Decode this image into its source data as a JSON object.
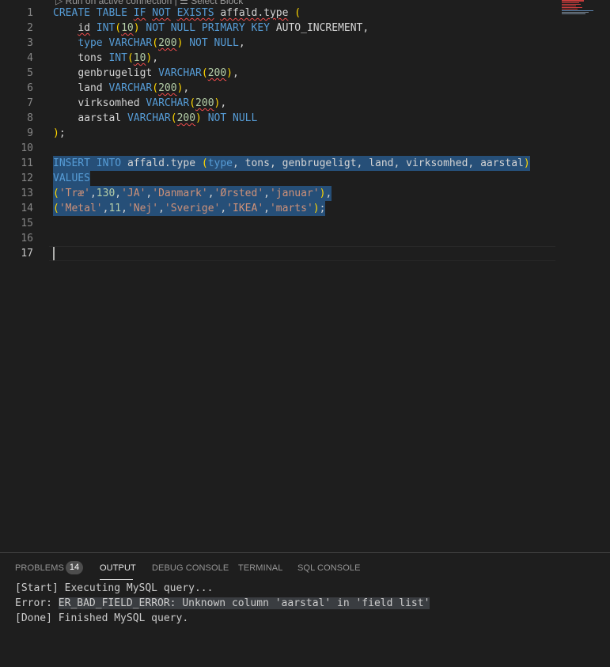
{
  "editor": {
    "codelens": "▷ Run on active connection | ☰ Select Block",
    "active_line": 17,
    "lines": [
      {
        "n": "1"
      },
      {
        "n": "2"
      },
      {
        "n": "3"
      },
      {
        "n": "4"
      },
      {
        "n": "5"
      },
      {
        "n": "6"
      },
      {
        "n": "7"
      },
      {
        "n": "8"
      },
      {
        "n": "9"
      },
      {
        "n": "10"
      },
      {
        "n": "11"
      },
      {
        "n": "12"
      },
      {
        "n": "13"
      },
      {
        "n": "14"
      },
      {
        "n": "15"
      },
      {
        "n": "16"
      },
      {
        "n": "17"
      }
    ],
    "code": {
      "l1": {
        "t1": "CREATE",
        "t2": "TABLE",
        "t3": "IF",
        "t4": "NOT",
        "t5": "EXISTS",
        "t6": "affald.type",
        "t7": "("
      },
      "l2": {
        "t1": "id",
        "t2": "INT",
        "t3": "(",
        "t4": "10",
        "t5": ")",
        "t6": "NOT",
        "t7": "NULL",
        "t8": "PRIMARY",
        "t9": "KEY",
        "t10": "AUTO_INCREMENT,"
      },
      "l3": {
        "t1": "type",
        "t2": "VARCHAR",
        "t3": "(",
        "t4": "200",
        "t5": ")",
        "t6": "NOT",
        "t7": "NULL",
        "t8": ","
      },
      "l4": {
        "t1": "tons",
        "t2": "INT",
        "t3": "(",
        "t4": "10",
        "t5": ")",
        "t6": ","
      },
      "l5": {
        "t1": "genbrugeligt",
        "t2": "VARCHAR",
        "t3": "(",
        "t4": "200",
        "t5": ")",
        "t6": ","
      },
      "l6": {
        "t1": "land",
        "t2": "VARCHAR",
        "t3": "(",
        "t4": "200",
        "t5": ")",
        "t6": ","
      },
      "l7": {
        "t1": "virksomhed",
        "t2": "VARCHAR",
        "t3": "(",
        "t4": "200",
        "t5": ")",
        "t6": ","
      },
      "l8": {
        "t1": "aarstal",
        "t2": "VARCHAR",
        "t3": "(",
        "t4": "200",
        "t5": ")",
        "t6": "NOT",
        "t7": "NULL"
      },
      "l9": {
        "t1": ")",
        "t2": ";"
      },
      "l11": {
        "t1": "INSERT",
        "t2": "INTO",
        "t3": "affald.type",
        "t4": "(",
        "t5": "type",
        "t6": ", tons, genbrugeligt, land, virksomhed, aarstal",
        "t7": ")"
      },
      "l12": {
        "t1": "VALUES"
      },
      "l13": {
        "t1": "(",
        "t2": "'Træ'",
        "t3": ",",
        "t4": "130",
        "t5": ",",
        "t6": "'JA'",
        "t7": ",",
        "t8": "'Danmark'",
        "t9": ",",
        "t10": "'Ørsted'",
        "t11": ",",
        "t12": "'januar'",
        "t13": ")",
        "t14": ","
      },
      "l14": {
        "t1": "(",
        "t2": "'Metal'",
        "t3": ",",
        "t4": "11",
        "t5": ",",
        "t6": "'Nej'",
        "t7": ",",
        "t8": "'Sverige'",
        "t9": ",",
        "t10": "'IKEA'",
        "t11": ",",
        "t12": "'marts'",
        "t13": ")",
        "t14": ";"
      }
    }
  },
  "panel": {
    "tabs": {
      "problems": "PROBLEMS",
      "problems_count": "14",
      "output": "OUTPUT",
      "debug_console": "DEBUG CONSOLE",
      "terminal": "TERMINAL",
      "sql_console": "SQL CONSOLE"
    },
    "output": {
      "line1": "[Start] Executing MySQL query...",
      "line2_prefix": "Error: ",
      "line2_error": "ER_BAD_FIELD_ERROR: Unknown column 'aarstal' in 'field list'",
      "line3": "[Done] Finished MySQL query."
    }
  },
  "colors": {
    "background": "#1e1e1e",
    "keyword": "#569cd6",
    "string": "#ce9178",
    "number": "#b5cea8",
    "bracket": "#ffd700",
    "selection": "#264f78",
    "error_squiggle": "#f14c4c"
  }
}
